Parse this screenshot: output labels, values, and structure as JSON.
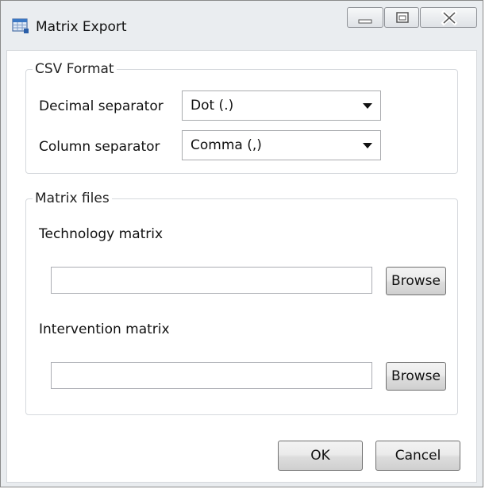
{
  "window": {
    "title": "Matrix Export"
  },
  "csv_format": {
    "legend": "CSV Format",
    "decimal_separator": {
      "label": "Decimal separator",
      "selected": "Dot (.)"
    },
    "column_separator": {
      "label": "Column separator",
      "selected": "Comma (,)"
    }
  },
  "matrix_files": {
    "legend": "Matrix files",
    "technology": {
      "label": "Technology matrix",
      "value": "",
      "browse_label": "Browse"
    },
    "intervention": {
      "label": "Intervention matrix",
      "value": "",
      "browse_label": "Browse"
    }
  },
  "footer": {
    "ok_label": "OK",
    "cancel_label": "Cancel"
  }
}
